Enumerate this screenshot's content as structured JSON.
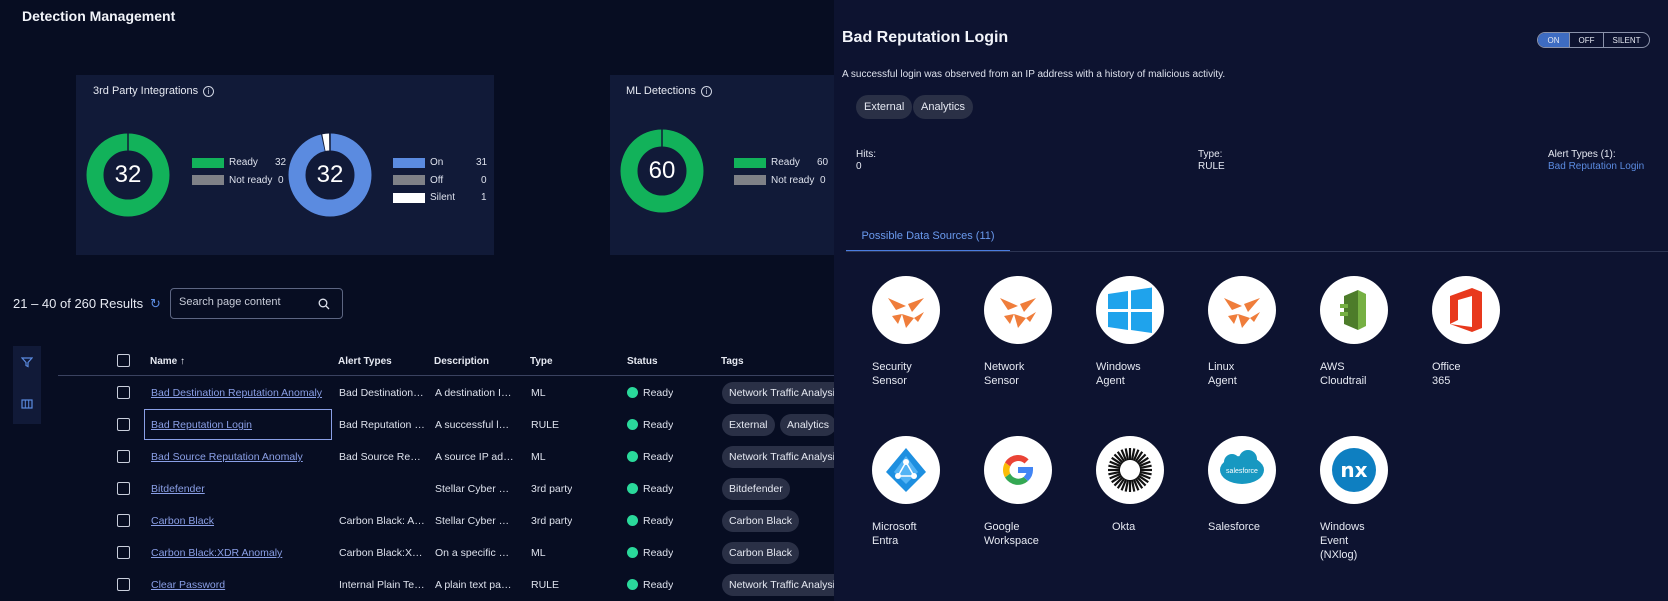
{
  "page": {
    "title": "Detection Management"
  },
  "cards": {
    "third_party": {
      "title": "3rd Party Integrations",
      "info_icon": "info-icon",
      "donut_ready": {
        "center": "32",
        "legend": [
          {
            "label": "Ready",
            "value": "32",
            "color": "#12b25a"
          },
          {
            "label": "Not ready",
            "value": "0",
            "color": "#7f8187"
          }
        ],
        "fractions": [
          1.0,
          0.0
        ]
      },
      "donut_status": {
        "center": "32",
        "legend": [
          {
            "label": "On",
            "value": "31",
            "color": "#5b8be0"
          },
          {
            "label": "Off",
            "value": "0",
            "color": "#7f8187"
          },
          {
            "label": "Silent",
            "value": "1",
            "color": "#ffffff"
          }
        ],
        "fractions": [
          0.96875,
          0.0,
          0.03125
        ]
      }
    },
    "ml": {
      "title": "ML Detections",
      "info_icon": "info-icon",
      "donut_ready": {
        "center": "60",
        "legend": [
          {
            "label": "Ready",
            "value": "60",
            "color": "#12b25a"
          },
          {
            "label": "Not ready",
            "value": "0",
            "color": "#7f8187"
          }
        ],
        "fractions": [
          1.0,
          0.0
        ]
      }
    }
  },
  "results": {
    "text": "21 – 40 of 260 Results",
    "refresh_icon": "refresh-icon"
  },
  "search": {
    "placeholder": "Search page content",
    "value": ""
  },
  "side_tools": {
    "filter_icon": "filter-icon",
    "columns_icon": "columns-icon"
  },
  "table": {
    "headers": {
      "name": "Name",
      "sort_icon": "↑",
      "alert_types": "Alert Types",
      "description": "Description",
      "type": "Type",
      "status": "Status",
      "tags": "Tags"
    },
    "rows": [
      {
        "name": "Bad Destination Reputation Anomaly",
        "alert_types": "Bad Destination Reputation Anomaly",
        "description": "A destination IP address with a bad reputation",
        "type": "ML",
        "status": "Ready",
        "tags": [
          "Network Traffic Analysis"
        ]
      },
      {
        "name": "Bad Reputation Login",
        "alert_types": "Bad Reputation Login",
        "description": "A successful login was observed",
        "type": "RULE",
        "status": "Ready",
        "tags": [
          "External",
          "Analytics"
        ]
      },
      {
        "name": "Bad Source Reputation Anomaly",
        "alert_types": "Bad Source Reputation Anomaly",
        "description": "A source IP address with a bad reputation",
        "type": "ML",
        "status": "Ready",
        "tags": [
          "Network Traffic Analysis"
        ]
      },
      {
        "name": "Bitdefender",
        "alert_types": "",
        "description": "Stellar Cyber detections from Bitdefender",
        "type": "3rd party",
        "status": "Ready",
        "tags": [
          "Bitdefender"
        ]
      },
      {
        "name": "Carbon Black",
        "alert_types": "Carbon Black: Alert",
        "description": "Stellar Cyber detections from Carbon Black",
        "type": "3rd party",
        "status": "Ready",
        "tags": [
          "Carbon Black"
        ]
      },
      {
        "name": "Carbon Black:XDR Anomaly",
        "alert_types": "Carbon Black:XDR Anomaly",
        "description": "On a specific host, an anomaly",
        "type": "ML",
        "status": "Ready",
        "tags": [
          "Carbon Black"
        ]
      },
      {
        "name": "Clear Password",
        "alert_types": "Internal Plain Text Password",
        "description": "A plain text password was observed",
        "type": "RULE",
        "status": "Ready",
        "tags": [
          "Network Traffic Analysis"
        ]
      }
    ]
  },
  "detail": {
    "title": "Bad Reputation Login",
    "toggle": {
      "options": [
        "ON",
        "OFF",
        "SILENT"
      ],
      "selected": "ON"
    },
    "description": "A successful login was observed from an IP address with a history of malicious activity.",
    "tags": [
      "External",
      "Analytics"
    ],
    "hits_label": "Hits:",
    "hits_value": "0",
    "type_label": "Type:",
    "type_value": "RULE",
    "alert_types_label": "Alert Types (1):",
    "alert_types_value": "Bad Reputation Login",
    "tab": "Possible Data Sources (11)",
    "sources": [
      {
        "label": "Security\nSensor",
        "icon": "stellar-sensor-icon"
      },
      {
        "label": "Network\nSensor",
        "icon": "stellar-sensor-icon"
      },
      {
        "label": "Windows\nAgent",
        "icon": "windows-icon"
      },
      {
        "label": "Linux\nAgent",
        "icon": "stellar-sensor-icon"
      },
      {
        "label": "AWS\nCloudtrail",
        "icon": "aws-cloudtrail-icon"
      },
      {
        "label": "Office\n365",
        "icon": "office365-icon"
      },
      {
        "label": "Microsoft\nEntra",
        "icon": "microsoft-entra-icon"
      },
      {
        "label": "Google\nWorkspace",
        "icon": "google-icon"
      },
      {
        "label": "Okta",
        "icon": "okta-icon"
      },
      {
        "label": "Salesforce",
        "icon": "salesforce-icon"
      },
      {
        "label": "Windows\nEvent\n(NXlog)",
        "icon": "nxlog-icon"
      }
    ]
  }
}
